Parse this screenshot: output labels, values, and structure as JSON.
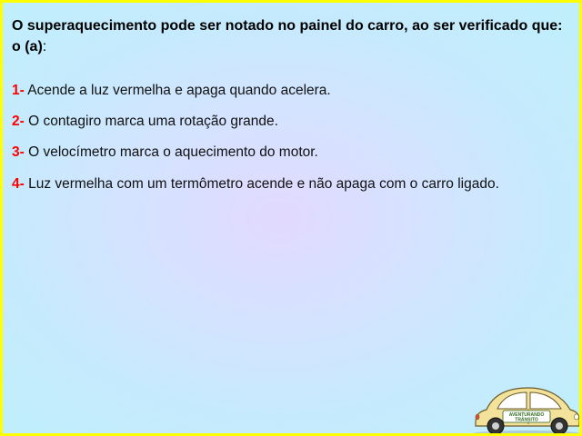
{
  "question": {
    "text": "O superaquecimento pode ser notado no painel do carro, ao ser verificado que: o (a)",
    "suffix": ":"
  },
  "options": [
    {
      "number": "1-",
      "text": " Acende a luz vermelha e apaga quando acelera."
    },
    {
      "number": "2-",
      "text": " O contagiro marca uma rotação grande."
    },
    {
      "number": "3-",
      "text": " O velocímetro marca o aquecimento do motor."
    },
    {
      "number": "4-",
      "text": " Luz vermelha com um termômetro acende e não apaga com o carro ligado."
    }
  ],
  "logo": {
    "line1": "AVENTURANDO",
    "line2": "TRÂNSITO"
  },
  "colors": {
    "border": "#ffff00",
    "option_number": "#ff0000",
    "car_body": "#f2e29a"
  }
}
